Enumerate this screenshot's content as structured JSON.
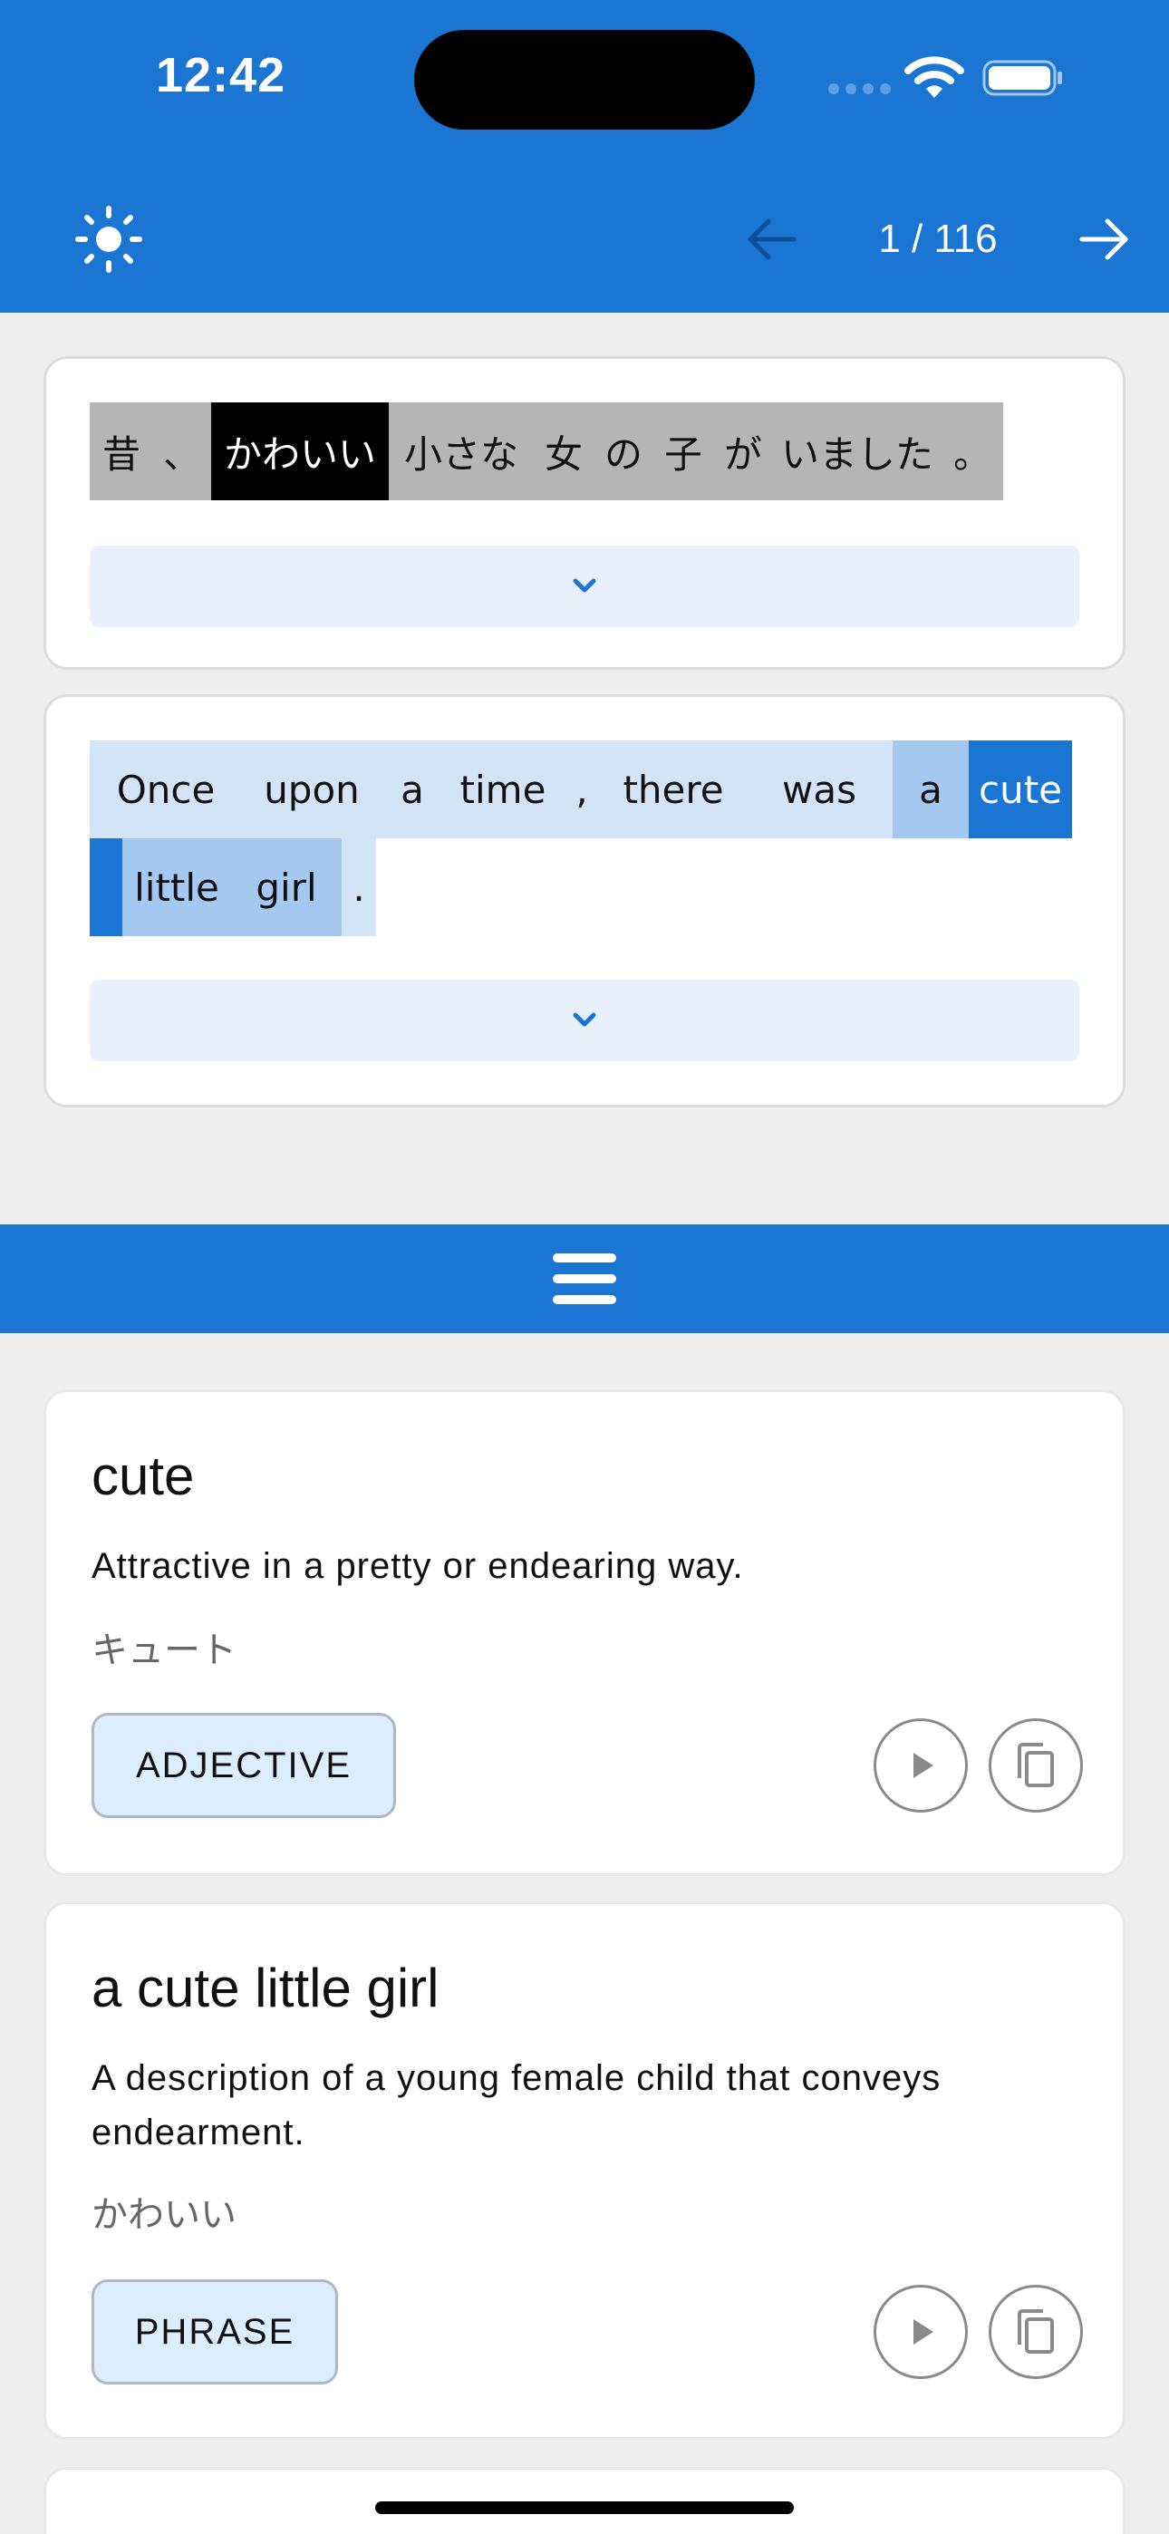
{
  "status_bar": {
    "time": "12:42"
  },
  "toolbar": {
    "page_counter": "1 / 116"
  },
  "japanese_sentence": {
    "tokens": [
      "昔",
      "、",
      "かわいい",
      "小さな",
      "女",
      "の",
      "子",
      "が",
      "いました",
      "。"
    ],
    "selected_token": "かわいい"
  },
  "english_sentence": {
    "tokens": [
      "Once",
      "upon",
      "a",
      "time",
      ",",
      "there",
      "was",
      "a",
      "cute",
      "little",
      "girl",
      "."
    ],
    "highlighted_tokens": [
      "a",
      "little",
      "girl"
    ],
    "selected_token": "cute"
  },
  "definitions": [
    {
      "term": "cute",
      "meaning": "Attractive in a pretty or endearing way.",
      "reading": "キュート",
      "part_of_speech": "ADJECTIVE"
    },
    {
      "term": "a cute little girl",
      "meaning": "A description of a young female child that conveys endearment.",
      "reading": "かわいい",
      "part_of_speech": "PHRASE"
    }
  ],
  "colors": {
    "accent": "#1a76d2",
    "selection_light": "#a4c8ef",
    "token_bg": "#d3e4f7",
    "jp_token_bg": "#b5b5b5"
  },
  "icons": [
    "brightness-icon",
    "arrow-left-icon",
    "arrow-right-icon",
    "chevron-down-icon",
    "menu-icon",
    "play-icon",
    "copy-icon"
  ]
}
